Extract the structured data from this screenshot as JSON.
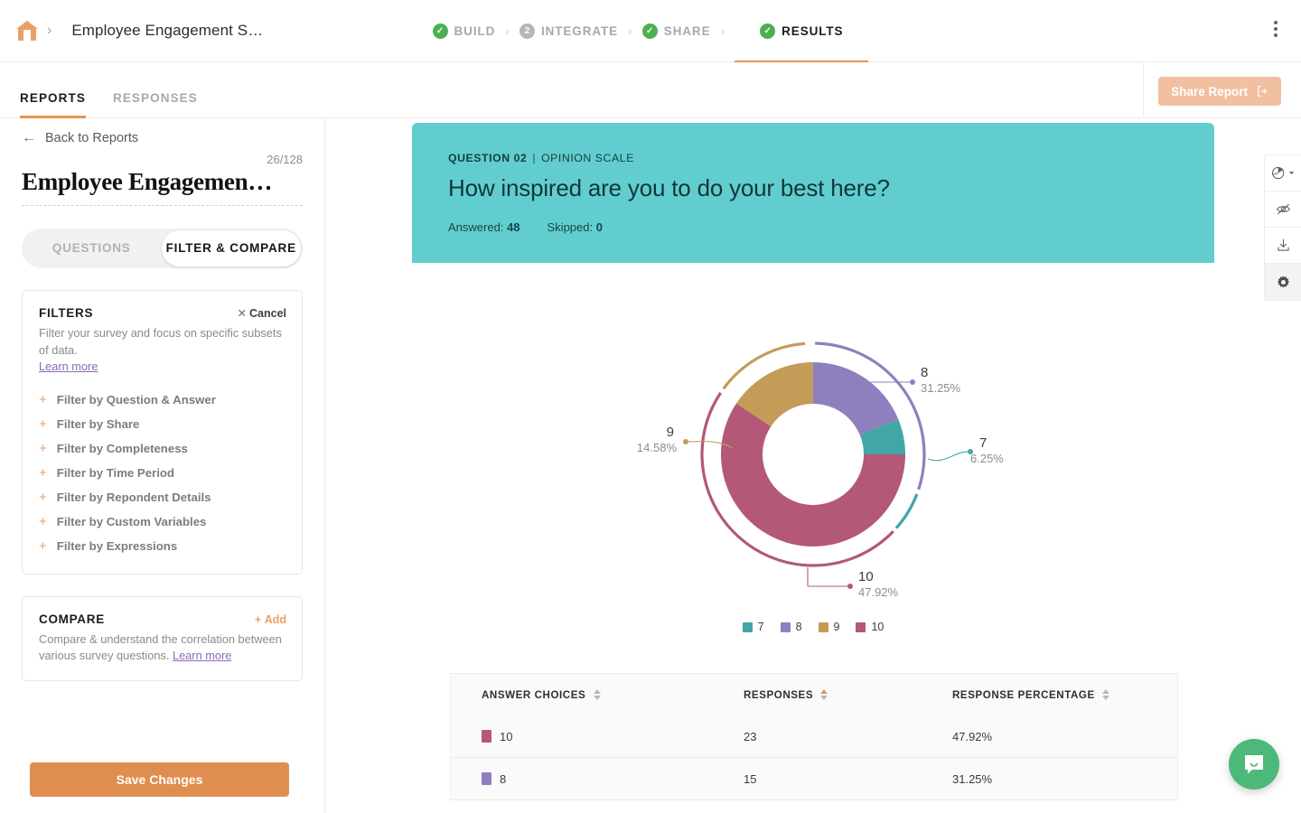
{
  "header": {
    "home_icon": "home-icon",
    "breadcrumb_title": "Employee Engagement S…",
    "kebab_icon": "more-vertical-icon",
    "steps": [
      {
        "label": "BUILD",
        "badge": "✓",
        "state": "done"
      },
      {
        "label": "INTEGRATE",
        "badge": "2",
        "state": "pending"
      },
      {
        "label": "SHARE",
        "badge": "✓",
        "state": "done"
      },
      {
        "label": "RESULTS",
        "badge": "✓",
        "state": "current"
      }
    ],
    "separator": "›"
  },
  "tabbar": {
    "tabs": [
      {
        "label": "REPORTS",
        "active": true
      },
      {
        "label": "RESPONSES",
        "active": false
      }
    ],
    "share_label": "Share Report",
    "share_icon": "external-link-icon"
  },
  "sidebar": {
    "back_label": "Back to Reports",
    "back_icon": "arrow-left-icon",
    "counter": "26/128",
    "title": "Employee Engagemen…",
    "segmented": [
      {
        "label": "QUESTIONS",
        "active": false
      },
      {
        "label": "FILTER & COMPARE",
        "active": true
      }
    ],
    "filters": {
      "title": "FILTERS",
      "cancel_label": "Cancel",
      "description": "Filter your survey and focus on specific subsets of data.",
      "learn_more": "Learn more",
      "items": [
        "Filter by Question & Answer",
        "Filter by Share",
        "Filter by Completeness",
        "Filter by Time Period",
        "Filter by Repondent Details",
        "Filter by Custom Variables",
        "Filter by Expressions"
      ]
    },
    "compare": {
      "title": "COMPARE",
      "add_label": "Add",
      "description": "Compare & understand the correlation between various survey questions. ",
      "learn_more": "Learn more"
    },
    "save_label": "Save Changes"
  },
  "question": {
    "number_label": "QUESTION 02",
    "type_label": "OPINION SCALE",
    "text": "How inspired are you to do your best here?",
    "answered_label": "Answered:",
    "answered_value": "48",
    "skipped_label": "Skipped:",
    "skipped_value": "0"
  },
  "toolbar_right": {
    "items": [
      {
        "icon": "pie-chart-dropdown-icon"
      },
      {
        "icon": "eye-slash-icon"
      },
      {
        "icon": "download-icon"
      },
      {
        "icon": "gear-icon"
      }
    ]
  },
  "chart_data": {
    "type": "pie",
    "title": "How inspired are you to do your best here?",
    "donut": true,
    "total_responses": 48,
    "categories": [
      "7",
      "8",
      "9",
      "10"
    ],
    "values": [
      3,
      15,
      7,
      23
    ],
    "percentages": [
      "6.25%",
      "31.25%",
      "14.58%",
      "47.92%"
    ],
    "colors": [
      "#43a6a6",
      "#8f7fbe",
      "#c59b58",
      "#b35878"
    ],
    "legend": [
      "7",
      "8",
      "9",
      "10"
    ],
    "legend_position": "bottom",
    "labels": [
      {
        "name": "8",
        "pct": "31.25%"
      },
      {
        "name": "7",
        "pct": "6.25%"
      },
      {
        "name": "10",
        "pct": "47.92%"
      },
      {
        "name": "9",
        "pct": "14.58%"
      }
    ],
    "xlabel": "",
    "ylabel": ""
  },
  "table": {
    "columns": [
      "ANSWER CHOICES",
      "RESPONSES",
      "RESPONSE PERCENTAGE"
    ],
    "sorted_column": 1,
    "rows": [
      {
        "choice": "10",
        "color": "#b35878",
        "responses": "23",
        "percentage": "47.92%"
      },
      {
        "choice": "8",
        "color": "#8f7fbe",
        "responses": "15",
        "percentage": "31.25%"
      }
    ]
  },
  "chat": {
    "icon": "chat-bubble-icon"
  }
}
